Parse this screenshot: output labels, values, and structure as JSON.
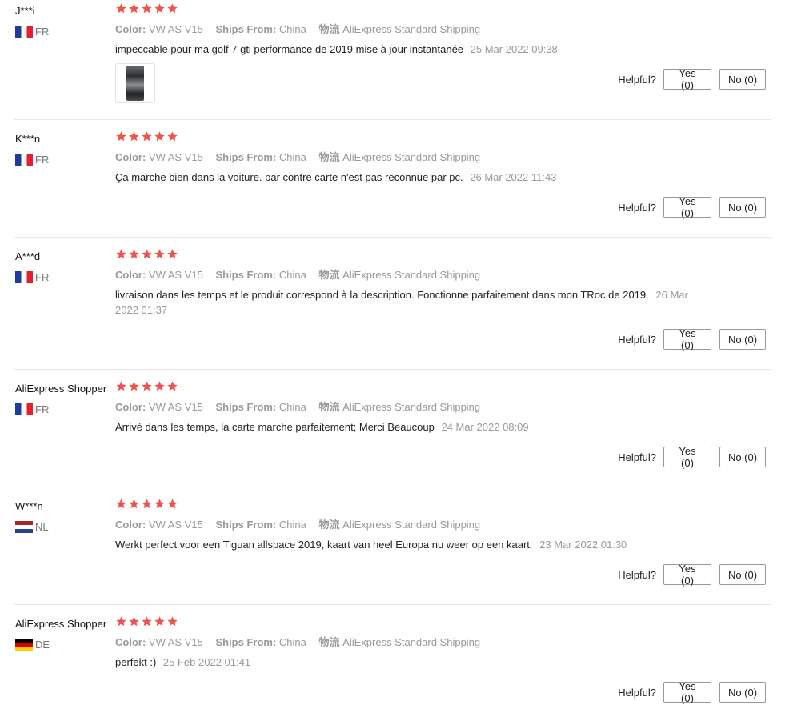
{
  "labels": {
    "color": "Color:",
    "ships_from": "Ships From:",
    "logistics": "物流",
    "helpful": "Helpful?"
  },
  "colors": {
    "star": "#ef5350",
    "meta_text": "#999999"
  },
  "reviews": [
    {
      "user": "J***i",
      "country": "FR",
      "flag": "fr",
      "rating": 5,
      "color": "VW AS V15",
      "ships_from": "China",
      "shipping": "AliExpress Standard Shipping",
      "text": "impeccable pour ma golf 7 gti performance de 2019 mise à jour instantanée",
      "date": "25 Mar 2022 09:38",
      "has_photo": true,
      "yes": "Yes (0)",
      "no": "No (0)"
    },
    {
      "user": "K***n",
      "country": "FR",
      "flag": "fr",
      "rating": 5,
      "color": "VW AS V15",
      "ships_from": "China",
      "shipping": "AliExpress Standard Shipping",
      "text": "Ça marche bien dans la voiture. par contre carte n'est pas reconnue par pc.",
      "date": "26 Mar 2022 11:43",
      "has_photo": false,
      "yes": "Yes (0)",
      "no": "No (0)"
    },
    {
      "user": "A***d",
      "country": "FR",
      "flag": "fr",
      "rating": 5,
      "color": "VW AS V15",
      "ships_from": "China",
      "shipping": "AliExpress Standard Shipping",
      "text": "livraison dans les temps et le produit correspond à la description. Fonctionne parfaitement dans mon TRoc de 2019.",
      "date": "26 Mar 2022 01:37",
      "has_photo": false,
      "yes": "Yes (0)",
      "no": "No (0)"
    },
    {
      "user": "AliExpress Shopper",
      "country": "FR",
      "flag": "fr",
      "rating": 5,
      "color": "VW AS V15",
      "ships_from": "China",
      "shipping": "AliExpress Standard Shipping",
      "text": "Arrivé dans les temps, la carte marche parfaitement; Merci Beaucoup",
      "date": "24 Mar 2022 08:09",
      "has_photo": false,
      "yes": "Yes (0)",
      "no": "No (0)"
    },
    {
      "user": "W***n",
      "country": "NL",
      "flag": "nl",
      "rating": 5,
      "color": "VW AS V15",
      "ships_from": "China",
      "shipping": "AliExpress Standard Shipping",
      "text": "Werkt perfect voor een Tiguan allspace 2019, kaart van heel Europa nu weer op een kaart.",
      "date": "23 Mar 2022 01:30",
      "has_photo": false,
      "yes": "Yes (0)",
      "no": "No (0)"
    },
    {
      "user": "AliExpress Shopper",
      "country": "DE",
      "flag": "de",
      "rating": 5,
      "color": "VW AS V15",
      "ships_from": "China",
      "shipping": "AliExpress Standard Shipping",
      "text": "perfekt :)",
      "date": "25 Feb 2022 01:41",
      "has_photo": false,
      "yes": "Yes (0)",
      "no": "No (0)"
    }
  ]
}
